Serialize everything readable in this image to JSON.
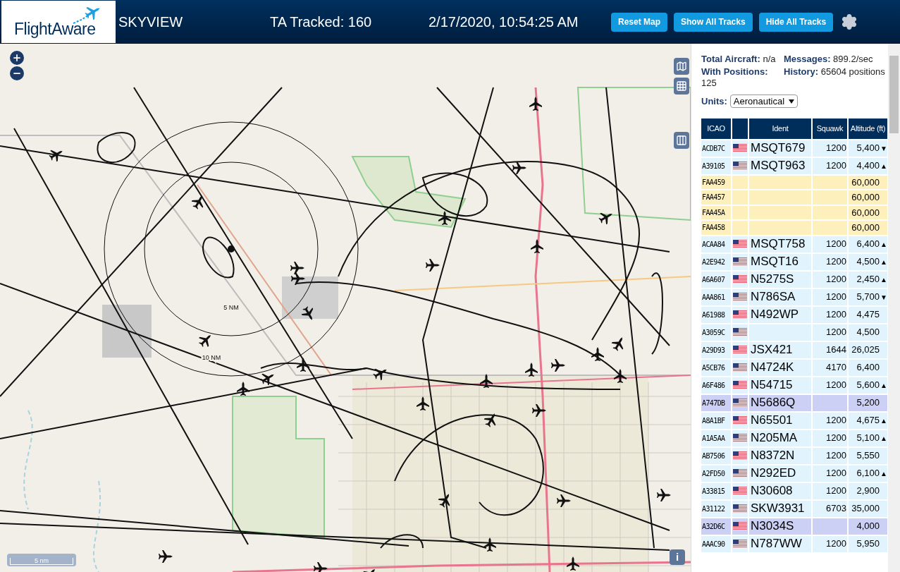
{
  "header": {
    "logo": "FlightAware",
    "title": "SKYVIEW",
    "tracked": "TA Tracked: 160",
    "datetime": "2/17/2020, 10:54:25 AM",
    "buttons": [
      "Reset Map",
      "Show All Tracks",
      "Hide All Tracks"
    ]
  },
  "map": {
    "ring_labels": [
      "5 NM",
      "10 NM"
    ],
    "scale": "5 nm",
    "info": "i"
  },
  "stats": [
    {
      "label": "Total Aircraft:",
      "value": "n/a"
    },
    {
      "label": "Messages:",
      "value": "899.2/sec"
    },
    {
      "label": "With Positions:",
      "value": "125"
    },
    {
      "label": "History:",
      "value": "65604 positions"
    }
  ],
  "units": {
    "label": "Units:",
    "value": "Aeronautical"
  },
  "table": {
    "columns": [
      "ICAO",
      "",
      "Ident",
      "Squawk",
      "Altitude (ft)"
    ],
    "rows": [
      {
        "kind": "adsb",
        "icao": "ACDB7C",
        "flag": true,
        "ident": "MSQT679",
        "squawk": "1200",
        "altitude": "5,400",
        "trend": "▼"
      },
      {
        "kind": "adsb",
        "icao": "A39105",
        "flag": true,
        "ident": "MSQT963",
        "squawk": "1200",
        "altitude": "4,400",
        "trend": "▲"
      },
      {
        "kind": "tisb",
        "icao": "FAA459",
        "flag": false,
        "ident": "",
        "squawk": "",
        "altitude": "60,000",
        "trend": ""
      },
      {
        "kind": "tisb",
        "icao": "FAA457",
        "flag": false,
        "ident": "",
        "squawk": "",
        "altitude": "60,000",
        "trend": ""
      },
      {
        "kind": "tisb",
        "icao": "FAA45A",
        "flag": false,
        "ident": "",
        "squawk": "",
        "altitude": "60,000",
        "trend": ""
      },
      {
        "kind": "tisb",
        "icao": "FAA458",
        "flag": false,
        "ident": "",
        "squawk": "",
        "altitude": "60,000",
        "trend": ""
      },
      {
        "kind": "adsb",
        "icao": "ACAA84",
        "flag": true,
        "ident": "MSQT758",
        "squawk": "1200",
        "altitude": "6,400",
        "trend": "▲"
      },
      {
        "kind": "adsb",
        "icao": "A2E942",
        "flag": true,
        "ident": "MSQT16",
        "squawk": "1200",
        "altitude": "4,500",
        "trend": "▲"
      },
      {
        "kind": "adsb",
        "icao": "A6A607",
        "flag": true,
        "ident": "N5275S",
        "squawk": "1200",
        "altitude": "2,450",
        "trend": "▲"
      },
      {
        "kind": "adsb",
        "icao": "AAA861",
        "flag": true,
        "ident": "N786SA",
        "squawk": "1200",
        "altitude": "5,700",
        "trend": "▼"
      },
      {
        "kind": "adsb",
        "icao": "A61988",
        "flag": true,
        "ident": "N492WP",
        "squawk": "1200",
        "altitude": "4,475",
        "trend": ""
      },
      {
        "kind": "adsb",
        "icao": "A3059C",
        "flag": true,
        "ident": "",
        "squawk": "1200",
        "altitude": "4,500",
        "trend": ""
      },
      {
        "kind": "adsb",
        "icao": "A29D93",
        "flag": true,
        "ident": "JSX421",
        "squawk": "1644",
        "altitude": "26,025",
        "trend": ""
      },
      {
        "kind": "adsb",
        "icao": "A5CB76",
        "flag": true,
        "ident": "N4724K",
        "squawk": "4170",
        "altitude": "6,400",
        "trend": ""
      },
      {
        "kind": "adsb",
        "icao": "A6F486",
        "flag": true,
        "ident": "N54715",
        "squawk": "1200",
        "altitude": "5,600",
        "trend": "▲"
      },
      {
        "kind": "mlat",
        "icao": "A747DB",
        "flag": true,
        "ident": "N5686Q",
        "squawk": "",
        "altitude": "5,200",
        "trend": ""
      },
      {
        "kind": "adsb",
        "icao": "A8A1BF",
        "flag": true,
        "ident": "N65501",
        "squawk": "1200",
        "altitude": "4,675",
        "trend": "▲"
      },
      {
        "kind": "adsb",
        "icao": "A1A5AA",
        "flag": true,
        "ident": "N205MA",
        "squawk": "1200",
        "altitude": "5,100",
        "trend": "▲"
      },
      {
        "kind": "adsb",
        "icao": "AB7506",
        "flag": true,
        "ident": "N8372N",
        "squawk": "1200",
        "altitude": "5,550",
        "trend": ""
      },
      {
        "kind": "adsb",
        "icao": "A2FD50",
        "flag": true,
        "ident": "N292ED",
        "squawk": "1200",
        "altitude": "6,100",
        "trend": "▲"
      },
      {
        "kind": "adsb",
        "icao": "A33815",
        "flag": true,
        "ident": "N30608",
        "squawk": "1200",
        "altitude": "2,900",
        "trend": ""
      },
      {
        "kind": "adsb",
        "icao": "A31122",
        "flag": true,
        "ident": "SKW3931",
        "squawk": "6703",
        "altitude": "35,000",
        "trend": ""
      },
      {
        "kind": "mlat",
        "icao": "A32D6C",
        "flag": true,
        "ident": "N3034S",
        "squawk": "",
        "altitude": "4,000",
        "trend": ""
      },
      {
        "kind": "adsb",
        "icao": "AAAC90",
        "flag": true,
        "ident": "N787WW",
        "squawk": "1200",
        "altitude": "5,950",
        "trend": ""
      }
    ]
  }
}
